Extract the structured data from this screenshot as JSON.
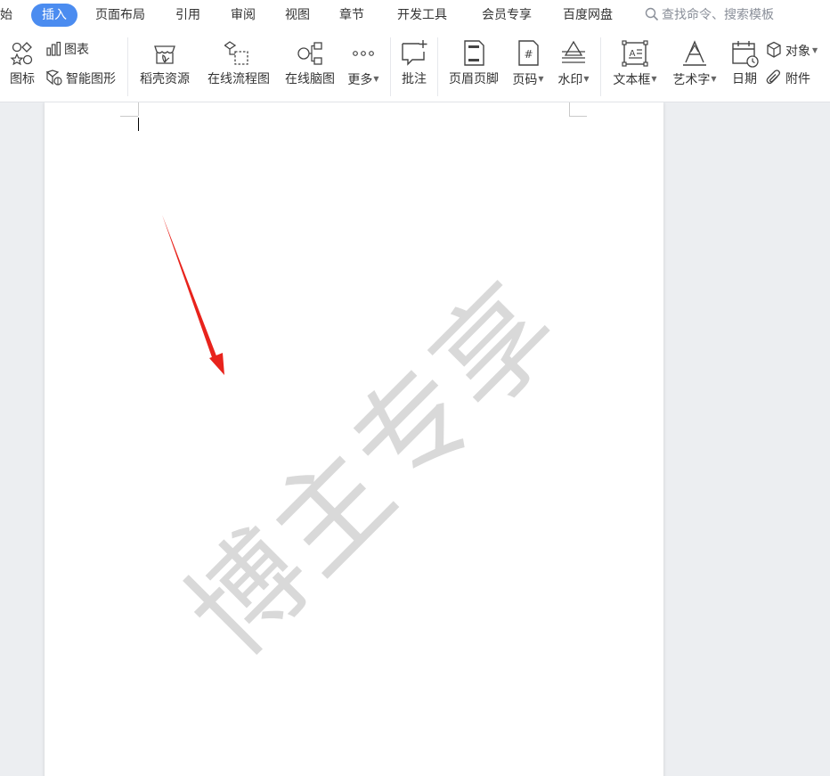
{
  "menubar": {
    "tabs": [
      {
        "label": "始",
        "active": false
      },
      {
        "label": "插入",
        "active": true
      },
      {
        "label": "页面布局",
        "active": false
      },
      {
        "label": "引用",
        "active": false
      },
      {
        "label": "审阅",
        "active": false
      },
      {
        "label": "视图",
        "active": false
      },
      {
        "label": "章节",
        "active": false
      },
      {
        "label": "开发工具",
        "active": false
      },
      {
        "label": "会员专享",
        "active": false
      },
      {
        "label": "百度网盘",
        "active": false
      }
    ],
    "search_placeholder": "查找命令、搜索模板"
  },
  "ribbon": {
    "icons_label": "图标",
    "chart_label": "图表",
    "smartart_label": "智能图形",
    "daoke_label": "稻壳资源",
    "flowchart_label": "在线流程图",
    "mindmap_label": "在线脑图",
    "more_label": "更多",
    "comment_label": "批注",
    "header_footer_label": "页眉页脚",
    "page_number_label": "页码",
    "watermark_label": "水印",
    "textbox_label": "文本框",
    "wordart_label": "艺术字",
    "date_label": "日期",
    "object_label": "对象",
    "attachment_label": "附件"
  },
  "document": {
    "watermark_text": "博主专享"
  },
  "colors": {
    "accent": "#4b8cf0",
    "watermark": "#d9d9d9",
    "annotation_arrow": "#e8231c"
  }
}
